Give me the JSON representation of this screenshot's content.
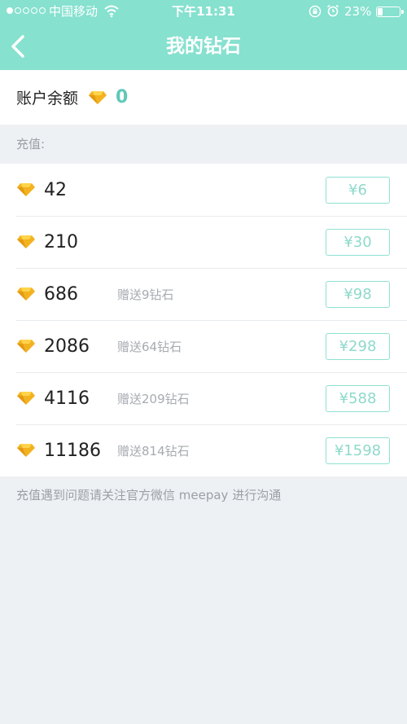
{
  "status_bar": {
    "carrier": "中国移动",
    "time": "下午11:31",
    "battery_percent": "23%",
    "battery_level": 0.23
  },
  "nav": {
    "title": "我的钻石",
    "back_icon": "chevron-left-icon"
  },
  "balance": {
    "label": "账户余额",
    "value": "0",
    "icon": "diamond-icon"
  },
  "section": {
    "label": "充值:"
  },
  "packages": [
    {
      "amount": "42",
      "bonus": "",
      "price": "¥6"
    },
    {
      "amount": "210",
      "bonus": "",
      "price": "¥30"
    },
    {
      "amount": "686",
      "bonus": "赠送9钻石",
      "price": "¥98"
    },
    {
      "amount": "2086",
      "bonus": "赠送64钻石",
      "price": "¥298"
    },
    {
      "amount": "4116",
      "bonus": "赠送209钻石",
      "price": "¥588"
    },
    {
      "amount": "11186",
      "bonus": "赠送814钻石",
      "price": "¥1598"
    }
  ],
  "footer": {
    "note": "充值遇到问题请关注官方微信 meepay 进行沟通"
  },
  "colors": {
    "header_bg": "#86e1cf",
    "accent": "#5fc9b9",
    "diamond": "#f3b21f",
    "page_bg": "#eef1f4"
  }
}
